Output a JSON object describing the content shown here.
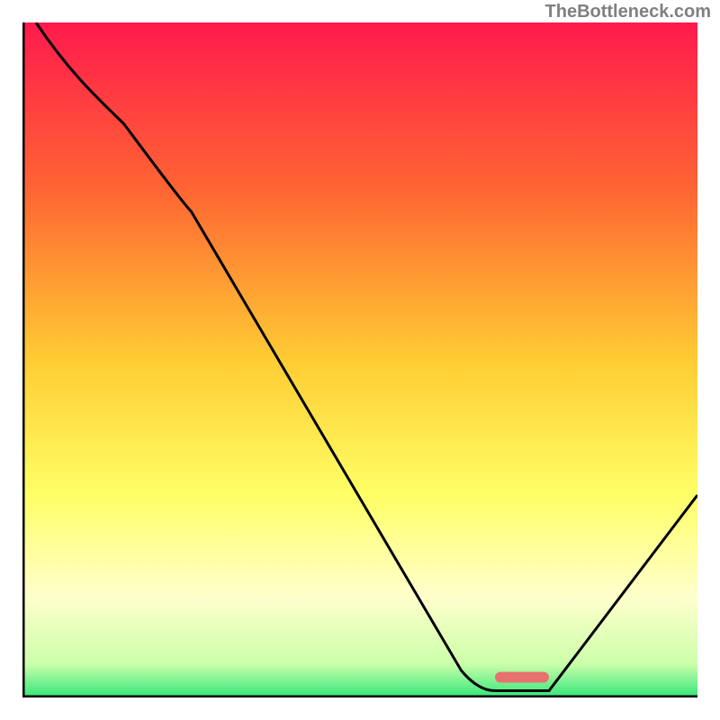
{
  "watermark": "TheBottleneck.com",
  "chart_data": {
    "type": "line",
    "title": "",
    "xlabel": "",
    "ylabel": "",
    "xlim": [
      0,
      100
    ],
    "ylim": [
      0,
      100
    ],
    "gradient_stops": [
      {
        "offset": 0,
        "color": "#ff1a4d"
      },
      {
        "offset": 25,
        "color": "#ff6633"
      },
      {
        "offset": 50,
        "color": "#ffcc33"
      },
      {
        "offset": 70,
        "color": "#ffff66"
      },
      {
        "offset": 85,
        "color": "#ffffcc"
      },
      {
        "offset": 95,
        "color": "#ccffaa"
      },
      {
        "offset": 100,
        "color": "#33e67a"
      }
    ],
    "curve_points": [
      {
        "x": 2,
        "y": 100
      },
      {
        "x": 15,
        "y": 85
      },
      {
        "x": 25,
        "y": 72
      },
      {
        "x": 65,
        "y": 4
      },
      {
        "x": 70,
        "y": 1
      },
      {
        "x": 78,
        "y": 1
      },
      {
        "x": 100,
        "y": 30
      }
    ],
    "marker": {
      "x_start": 70,
      "x_end": 78,
      "y": 3,
      "color": "#e8716f"
    },
    "axes_color": "#000000",
    "axes_width": 4,
    "curve_color": "#000000",
    "curve_width": 3
  }
}
